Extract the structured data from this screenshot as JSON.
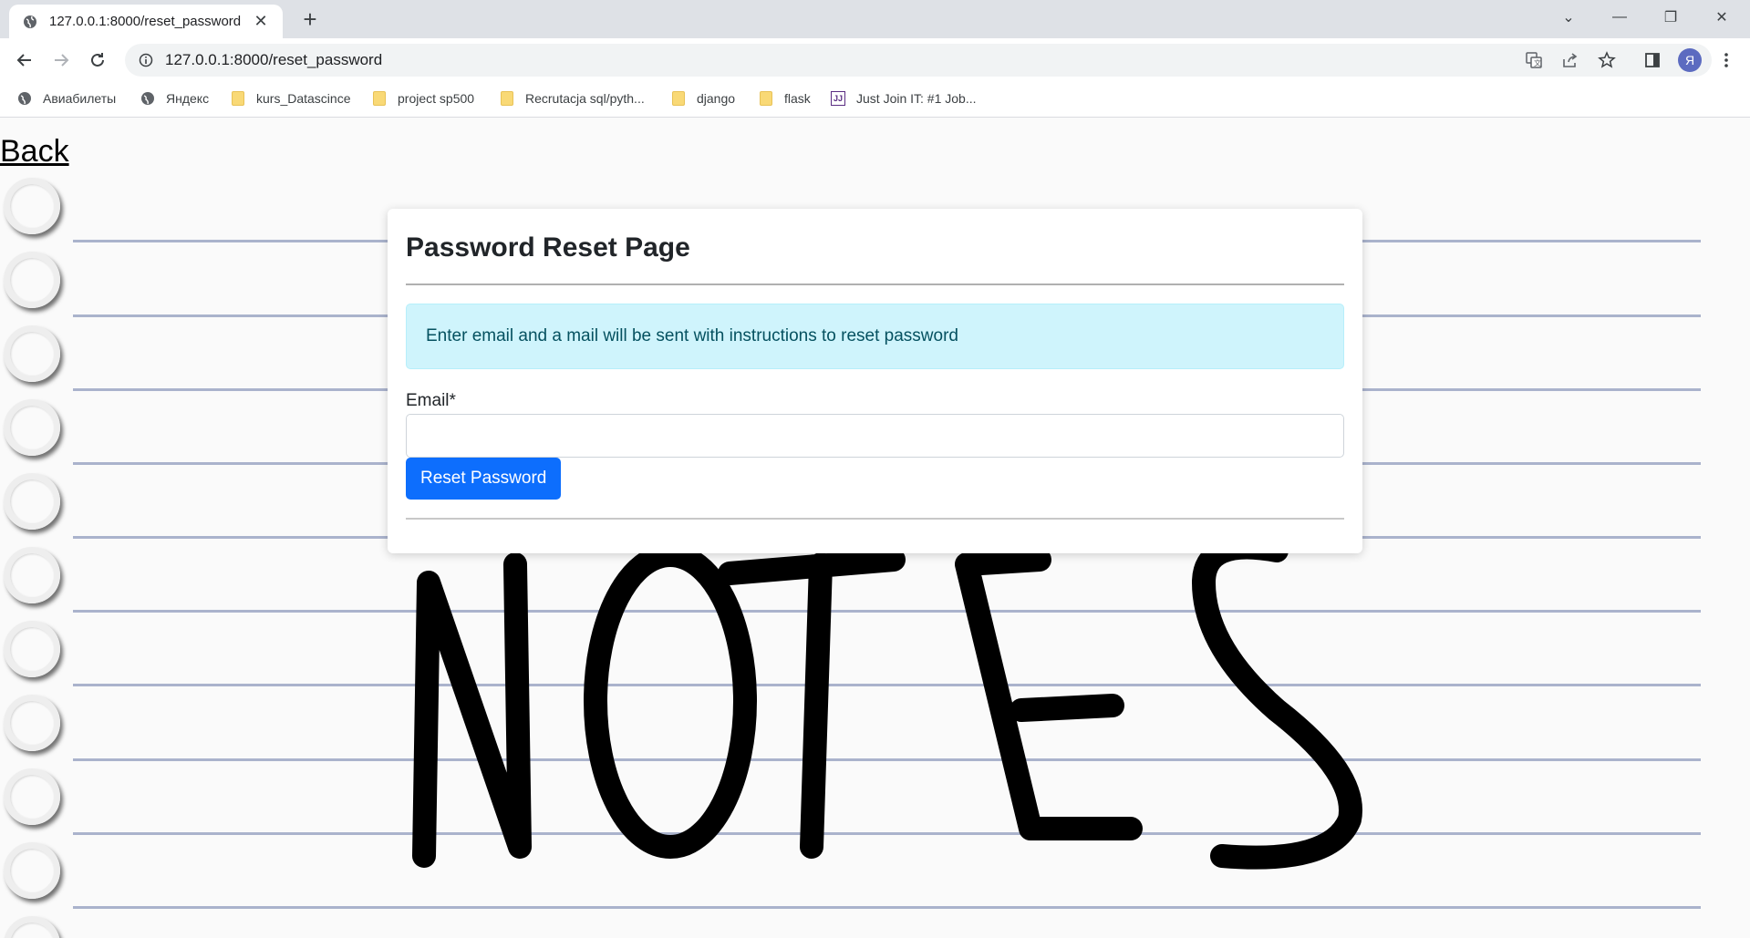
{
  "browser": {
    "tab": {
      "title": "127.0.0.1:8000/reset_password",
      "close": "✕"
    },
    "new_tab": "+",
    "window_controls": {
      "menu": "⌄",
      "minimize": "—",
      "restore": "❐",
      "close": "✕"
    },
    "url": "127.0.0.1:8000/reset_password",
    "avatar_letter": "Я",
    "bookmarks": [
      {
        "label": "Авиабилеты",
        "icon": "globe-icon"
      },
      {
        "label": "Яндекс",
        "icon": "globe-icon"
      },
      {
        "label": "kurs_Datascince",
        "icon": "folder-icon"
      },
      {
        "label": "project sp500",
        "icon": "folder-icon"
      },
      {
        "label": "Recrutacja sql/pyth...",
        "icon": "folder-icon"
      },
      {
        "label": "django",
        "icon": "folder-icon"
      },
      {
        "label": "flask",
        "icon": "folder-icon"
      },
      {
        "label": "Just Join IT: #1 Job...",
        "icon": "justjoin-icon"
      }
    ]
  },
  "page": {
    "back_link": "Back",
    "card": {
      "title": "Password Reset Page",
      "alert": "Enter email and a mail will be sent with instructions to reset password",
      "email_label": "Email*",
      "email_value": "",
      "submit_label": "Reset Password"
    },
    "background_art": "NOTES",
    "colors": {
      "primary": "#0d6efd",
      "alert_bg": "#cff4fc",
      "alert_text": "#055160",
      "notebook_line": "#aab3cc"
    }
  }
}
